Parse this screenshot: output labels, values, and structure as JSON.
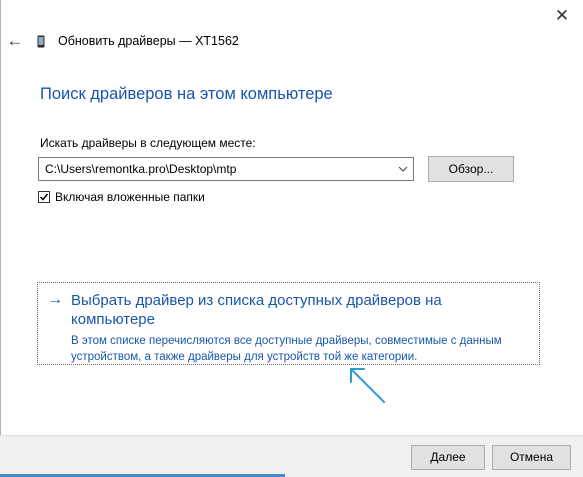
{
  "window": {
    "title": "Обновить драйверы — XT1562",
    "close_glyph": "✕",
    "back_glyph": "←"
  },
  "main": {
    "heading": "Поиск драйверов на этом компьютере",
    "path_label": "Искать драйверы в следующем месте:",
    "path_value": "C:\\Users\\remontka.pro\\Desktop\\mtp",
    "browse_label": "Обзор...",
    "include_subfolders_label": "Включая вложенные папки",
    "include_subfolders_checked": true
  },
  "choice": {
    "arrow_glyph": "→",
    "title": "Выбрать драйвер из списка доступных драйверов на компьютере",
    "description": "В этом списке перечисляются все доступные драйверы, совместимые с данным устройством, а также драйверы для устройств той же категории."
  },
  "footer": {
    "next_label": "Далее",
    "cancel_label": "Отмена"
  },
  "colors": {
    "link_blue": "#1a56a8",
    "annotation_arrow": "#2f9bd6",
    "footer_bg": "#f0f0f0",
    "button_bg": "#e1e1e1"
  },
  "icons": {
    "back": "back-arrow-icon",
    "device": "phone-device-icon",
    "close": "close-icon",
    "dropdown": "chevron-down-icon",
    "checkbox": "checkmark-icon",
    "choice": "arrow-right-icon",
    "annotation": "pointer-arrow-icon"
  }
}
